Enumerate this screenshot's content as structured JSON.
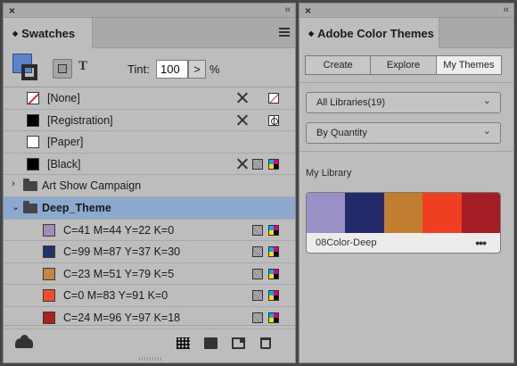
{
  "swatches_panel": {
    "tab_label": "Swatches",
    "tint_label": "Tint:",
    "tint_value": "100",
    "tint_arrow": ">",
    "tint_unit": "%",
    "type_button": "T",
    "fill_color": "#5b83c7",
    "swatches": [
      {
        "name": "[None]",
        "color": "none"
      },
      {
        "name": "[Registration]",
        "color": "#000000"
      },
      {
        "name": "[Paper]",
        "color": "#ffffff"
      },
      {
        "name": "[Black]",
        "color": "#000000"
      }
    ],
    "groups": [
      {
        "name": "Art Show Campaign",
        "expanded": false
      },
      {
        "name": "Deep_Theme",
        "expanded": true,
        "selected": true
      }
    ],
    "deep_theme_swatches": [
      {
        "name": "C=41 M=44 Y=22 K=0",
        "color": "#a28bb4"
      },
      {
        "name": "C=99 M=87 Y=37 K=30",
        "color": "#20336b"
      },
      {
        "name": "C=23 M=51 Y=79 K=5",
        "color": "#c48542"
      },
      {
        "name": "C=0 M=83 Y=91 K=0",
        "color": "#f24d2f"
      },
      {
        "name": "C=24 M=96 Y=97 K=18",
        "color": "#a9241f"
      }
    ]
  },
  "themes_panel": {
    "tab_label": "Adobe Color Themes",
    "segments": [
      "Create",
      "Explore",
      "My Themes"
    ],
    "library_dropdown": "All Libraries(19)",
    "sort_dropdown": "By Quantity",
    "section_label": "My Library",
    "theme_card": {
      "title": "08Color-Deep",
      "more": "•••",
      "colors": [
        "#9b90c6",
        "#222a6a",
        "#c27e30",
        "#ef3f22",
        "#a51d24"
      ]
    }
  }
}
